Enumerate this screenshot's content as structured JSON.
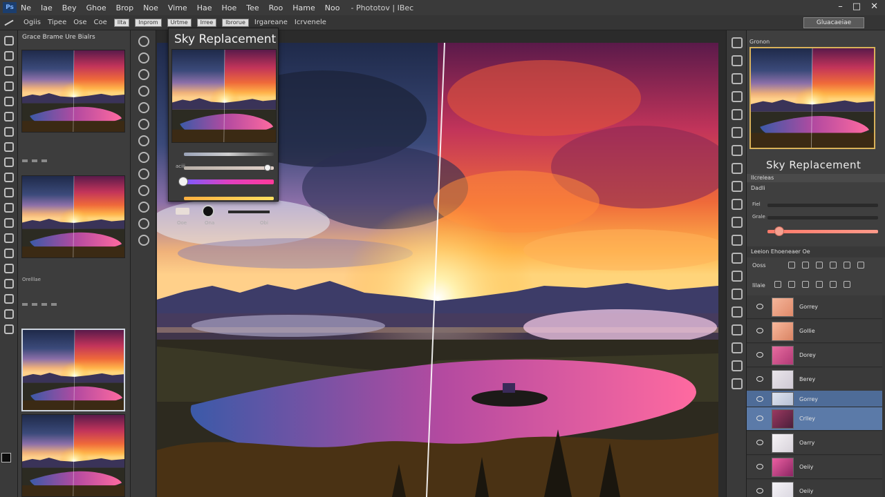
{
  "menubar": {
    "logo": "Ps",
    "items": [
      "Ne",
      "Iae",
      "Bey",
      "Ghoe",
      "Brop",
      "Noe",
      "Vime",
      "Hae",
      "Hoe",
      "Tee",
      "Roo",
      "Hame",
      "Noo"
    ],
    "title": "Phototov",
    "doc": "IBec",
    "controls": [
      "–",
      "□",
      "✕"
    ]
  },
  "optionsbar": {
    "chips": [
      "Ilta",
      "Inprom",
      "Urtme",
      "Irree",
      "Ibrorue"
    ],
    "texts": [
      "Ogiis",
      "Tipee",
      "Ose",
      "Coe",
      "Irgareane",
      "Icrvenele"
    ],
    "right_button": "Gluacaeiae"
  },
  "thumbnails": {
    "header": "Grace Brame Ure Bialrs",
    "footer_label": "Orelllae"
  },
  "sky_panel": {
    "title": "Sky Replacement",
    "rows": [
      {
        "label": "",
        "knob": 0
      },
      {
        "label": "aciii",
        "knob": 0.9
      },
      {
        "label": "",
        "knob": 0.05
      },
      {
        "label": "",
        "knob": 0.1
      }
    ],
    "bottom_labels": [
      "Ooe",
      "Ona",
      "Obi"
    ]
  },
  "right_panel": {
    "header": "Gronon",
    "sky_label": "Sky Replacement",
    "adj_header": "Ilcreleas",
    "adj_subhead": "Dadli",
    "adj_rows": [
      {
        "label": "Fiel"
      },
      {
        "label": "Grale"
      },
      {
        "label": ""
      }
    ]
  },
  "layers": {
    "header": "Leeion  Ehoeneaer  Oe",
    "tool_label": "Ooss",
    "filter_label": "Iilaie",
    "items": [
      {
        "name": "Gorrey",
        "color1": "#f4b59a",
        "color2": "#e08a6a"
      },
      {
        "name": "Gollie",
        "color1": "#f9b89c",
        "color2": "#d98464"
      },
      {
        "name": "Dorey",
        "color1": "#e86ca0",
        "color2": "#b13a76"
      },
      {
        "name": "Berey",
        "color1": "#e9e5ea",
        "color2": "#cfc9d4"
      },
      {
        "name": "Gorrey",
        "color1": "#dde3ef",
        "color2": "#b8c2d6"
      },
      {
        "name": "Crlley",
        "color1": "#9b3960",
        "color2": "#4a1e3a"
      },
      {
        "name": "Oarry",
        "color1": "#f6f3f6",
        "color2": "#d7d2da"
      },
      {
        "name": "Oeiiy",
        "color1": "#ec5fa2",
        "color2": "#8c2663"
      },
      {
        "name": "Oeiiy",
        "color1": "#f5f3f7",
        "color2": "#d9d6df"
      }
    ]
  },
  "colors": {
    "accent": "#5b7aa8",
    "nav_border": "#d9b25a"
  }
}
